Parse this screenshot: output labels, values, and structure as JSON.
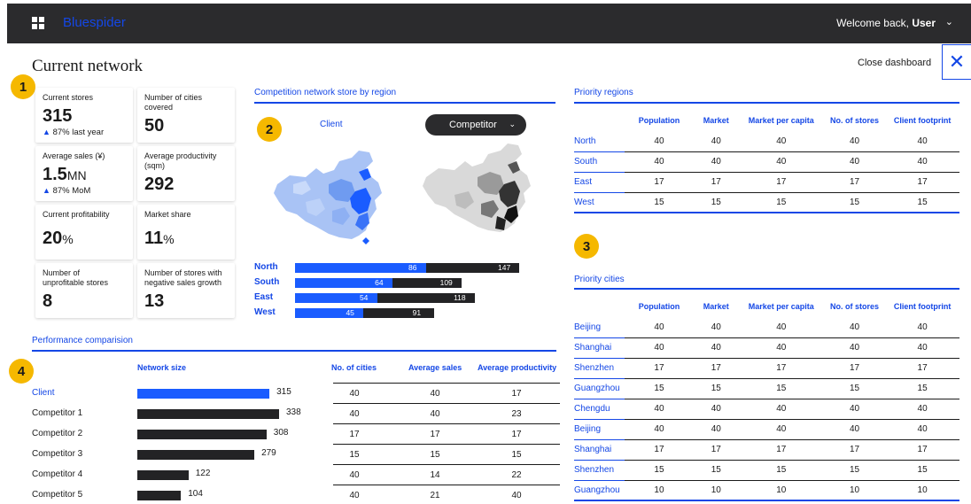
{
  "app": {
    "brand": "Bluespider",
    "welcome_prefix": "Welcome back,",
    "user": "User"
  },
  "header": {
    "title": "Current network",
    "close_label": "Close dashboard"
  },
  "badges": [
    "1",
    "2",
    "3",
    "4"
  ],
  "kpis": [
    {
      "label": "Current stores",
      "value": "315",
      "trend": "87% last year"
    },
    {
      "label": "Number of cities covered",
      "value": "50"
    },
    {
      "label": "Average sales (¥)",
      "value": "1.5",
      "unit": "MN",
      "trend": "87% MoM"
    },
    {
      "label": "Average productivity (sqm)",
      "value": "292"
    },
    {
      "label": "Current profitability",
      "value": "20",
      "unit": "%"
    },
    {
      "label": "Market share",
      "value": "11",
      "unit": "%"
    },
    {
      "label": "Number of unprofitable stores",
      "value": "8"
    },
    {
      "label": "Number of stores with negative sales growth",
      "value": "13"
    }
  ],
  "competition": {
    "title": "Competition network store by region",
    "client_label": "Client",
    "competitor_label": "Competitor",
    "regions": [
      {
        "name": "North",
        "client": 86,
        "competitor": 147
      },
      {
        "name": "South",
        "client": 64,
        "competitor": 109
      },
      {
        "name": "East",
        "client": 54,
        "competitor": 118
      },
      {
        "name": "West",
        "client": 45,
        "competitor": 91
      }
    ]
  },
  "priority_regions": {
    "title": "Priority regions",
    "columns": [
      "Population",
      "Market",
      "Market per capita",
      "No. of stores",
      "Client footprint"
    ],
    "rows": [
      {
        "name": "North",
        "values": [
          "40",
          "40",
          "40",
          "40",
          "40"
        ]
      },
      {
        "name": "South",
        "values": [
          "40",
          "40",
          "40",
          "40",
          "40"
        ]
      },
      {
        "name": "East",
        "values": [
          "17",
          "17",
          "17",
          "17",
          "17"
        ]
      },
      {
        "name": "West",
        "values": [
          "15",
          "15",
          "15",
          "15",
          "15"
        ]
      }
    ]
  },
  "priority_cities": {
    "title": "Priority cities",
    "columns": [
      "Population",
      "Market",
      "Market per capita",
      "No. of stores",
      "Client footprint"
    ],
    "rows": [
      {
        "name": "Beijing",
        "values": [
          "40",
          "40",
          "40",
          "40",
          "40"
        ]
      },
      {
        "name": "Shanghai",
        "values": [
          "40",
          "40",
          "40",
          "40",
          "40"
        ]
      },
      {
        "name": "Shenzhen",
        "values": [
          "17",
          "17",
          "17",
          "17",
          "17"
        ]
      },
      {
        "name": "Guangzhou",
        "values": [
          "15",
          "15",
          "15",
          "15",
          "15"
        ]
      },
      {
        "name": "Chengdu",
        "values": [
          "40",
          "40",
          "40",
          "40",
          "40"
        ]
      },
      {
        "name": "Beijing",
        "values": [
          "40",
          "40",
          "40",
          "40",
          "40"
        ]
      },
      {
        "name": "Shanghai",
        "values": [
          "17",
          "17",
          "17",
          "17",
          "17"
        ]
      },
      {
        "name": "Shenzhen",
        "values": [
          "15",
          "15",
          "15",
          "15",
          "15"
        ]
      },
      {
        "name": "Guangzhou",
        "values": [
          "10",
          "10",
          "10",
          "10",
          "10"
        ]
      }
    ]
  },
  "performance": {
    "title": "Performance comparision",
    "columns": [
      "Network size",
      "No. of cities",
      "Average sales",
      "Average productivity"
    ],
    "rows": [
      {
        "name": "Client",
        "network": 315,
        "cities": "40",
        "sales": "40",
        "productivity": "17"
      },
      {
        "name": "Competitor 1",
        "network": 338,
        "cities": "40",
        "sales": "40",
        "productivity": "23"
      },
      {
        "name": "Competitor 2",
        "network": 308,
        "cities": "17",
        "sales": "17",
        "productivity": "17"
      },
      {
        "name": "Competitor 3",
        "network": 279,
        "cities": "15",
        "sales": "15",
        "productivity": "15"
      },
      {
        "name": "Competitor 4",
        "network": 122,
        "cities": "40",
        "sales": "14",
        "productivity": "22"
      },
      {
        "name": "Competitor 5",
        "network": 104,
        "cities": "40",
        "sales": "21",
        "productivity": "40"
      }
    ]
  },
  "colors": {
    "accent": "#1447e6",
    "client_bar": "#1a5cff",
    "dark": "#232325",
    "badge": "#f5b800"
  }
}
